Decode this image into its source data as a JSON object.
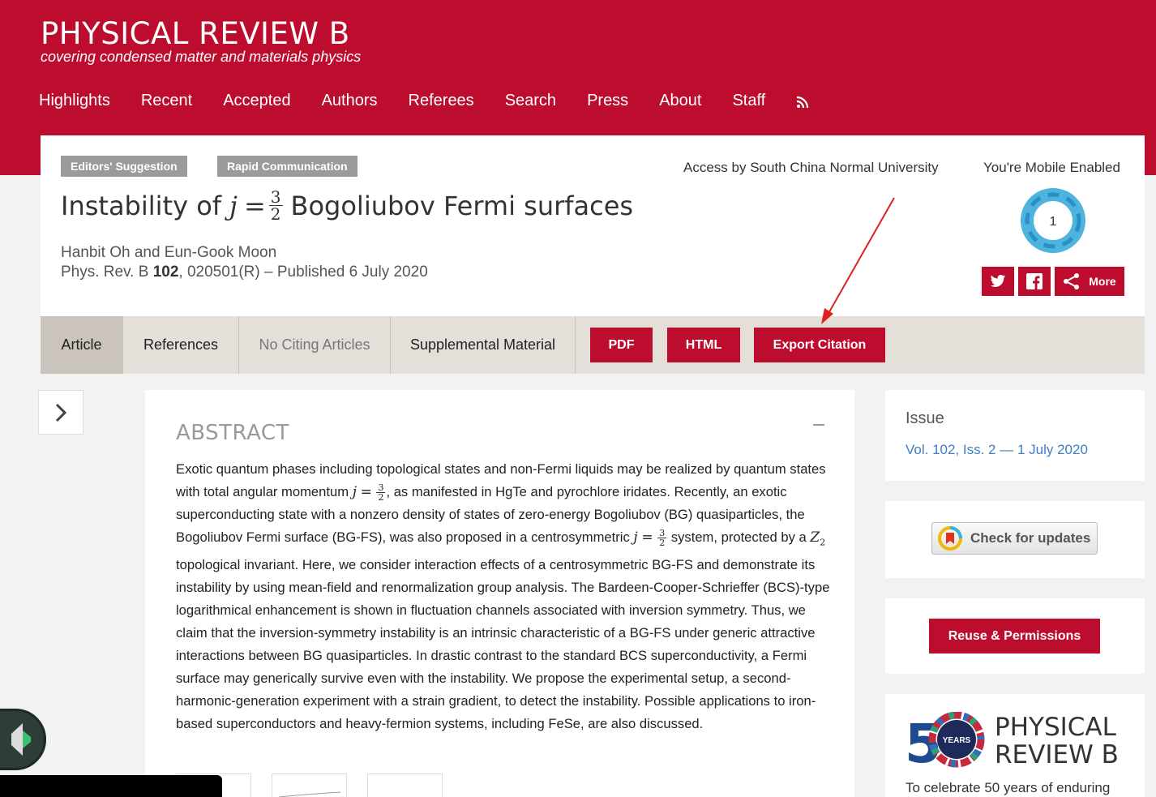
{
  "header": {
    "journal_title": "PHYSICAL REVIEW B",
    "journal_subtitle": "covering condensed matter and materials physics",
    "nav": [
      "Highlights",
      "Recent",
      "Accepted",
      "Authors",
      "Referees",
      "Search",
      "Press",
      "About",
      "Staff"
    ],
    "rss_icon": "rss-icon"
  },
  "article": {
    "badges": [
      "Editors' Suggestion",
      "Rapid Communication"
    ],
    "access_text": "Access by South China Normal University",
    "mobile_text": "You're Mobile Enabled",
    "title_prefix": "Instability of",
    "title_j": "j",
    "title_eq": "=",
    "title_num": "3",
    "title_den": "2",
    "title_suffix": "Bogoliubov Fermi surfaces",
    "authors": "Hanbit Oh and Eun-Gook Moon",
    "journal_ref": "Phys. Rev. B",
    "volume": "102",
    "citation_rest": ", 020501(R) – Published 6 July 2020",
    "altmetric_score": "1",
    "share_more": "More"
  },
  "tabs": {
    "article": "Article",
    "references": "References",
    "citing": "No Citing Articles",
    "supplemental": "Supplemental Material",
    "pdf": "PDF",
    "html": "HTML",
    "export": "Export Citation"
  },
  "abstract": {
    "heading": "ABSTRACT",
    "p1": "Exotic quantum phases including topological states and non-Fermi liquids may be realized by quantum states with total angular momentum",
    "p2": ", as manifested in HgTe and pyrochlore iridates. Recently, an exotic superconducting state with a nonzero density of states of zero-energy Bogoliubov (BG) quasiparticles, the Bogoliubov Fermi surface (BG-FS), was also proposed in a centrosymmetric",
    "p3": "system, protected by a",
    "p4": "topological invariant. Here, we consider interaction effects of a centrosymmetric BG-FS and demonstrate its instability by using mean-field and renormalization group analysis. The Bardeen-Cooper-Schrieffer (BCS)-type logarithmical enhancement is shown in fluctuation channels associated with inversion symmetry. Thus, we claim that the inversion-symmetry instability is an intrinsic characteristic of a BG-FS under generic attractive interactions between BG quasiparticles. In drastic contrast to the standard BCS superconductivity, a Fermi surface may generically survive even with the instability. We propose the experimental setup, a second-harmonic-generation experiment with a strain gradient, to detect the instability. Possible applications to iron-based superconductors and heavy-fermion systems, including FeSe, are also discussed.",
    "j": "j",
    "eq": "=",
    "num": "3",
    "den": "2",
    "z": "Z",
    "z_sub": "2"
  },
  "sidebar": {
    "issue_label": "Issue",
    "issue_link": "Vol. 102, Iss. 2 — 1 July 2020",
    "check_updates": "Check for updates",
    "reuse": "Reuse & Permissions",
    "prb50_line1": "PHYSICAL",
    "prb50_line2": "REVIEW B",
    "prb50_years": "YEARS",
    "prb50_text": "To celebrate 50 years of enduring"
  },
  "colors": {
    "brand": "#bc0d2f",
    "link": "#3d7fc1",
    "tabbar": "#e4dfd9"
  }
}
